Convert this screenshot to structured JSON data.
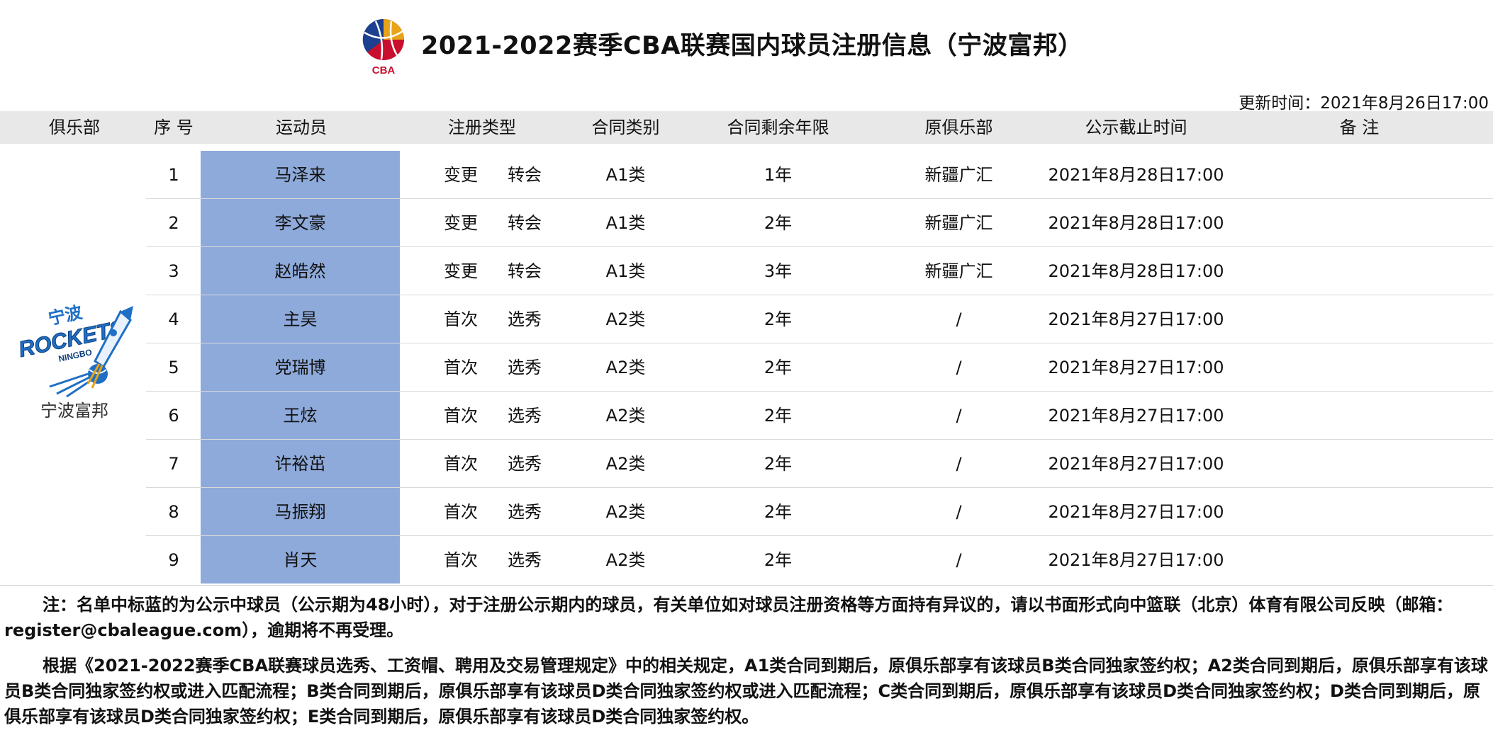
{
  "header": {
    "title": "2021-2022赛季CBA联赛国内球员注册信息（宁波富邦）",
    "logo_text": "CBA",
    "updated": "更新时间：2021年8月26日17:00"
  },
  "columns": [
    "俱乐部",
    "序 号",
    "运动员",
    "注册类型",
    "合同类别",
    "合同剩余年限",
    "原俱乐部",
    "公示截止时间",
    "备 注"
  ],
  "club": {
    "name": "宁波富邦",
    "logo_text": "ROCKETS",
    "logo_sub": "NINGBO",
    "logo_cn": "宁波"
  },
  "rows": [
    {
      "no": "1",
      "player": "马泽来",
      "reg1": "变更",
      "reg2": "转会",
      "contract": "A1类",
      "years": "1年",
      "orig": "新疆广汇",
      "deadline": "2021年8月28日17:00",
      "note": ""
    },
    {
      "no": "2",
      "player": "李文豪",
      "reg1": "变更",
      "reg2": "转会",
      "contract": "A1类",
      "years": "2年",
      "orig": "新疆广汇",
      "deadline": "2021年8月28日17:00",
      "note": ""
    },
    {
      "no": "3",
      "player": "赵皓然",
      "reg1": "变更",
      "reg2": "转会",
      "contract": "A1类",
      "years": "3年",
      "orig": "新疆广汇",
      "deadline": "2021年8月28日17:00",
      "note": ""
    },
    {
      "no": "4",
      "player": "主昊",
      "reg1": "首次",
      "reg2": "选秀",
      "contract": "A2类",
      "years": "2年",
      "orig": "/",
      "deadline": "2021年8月27日17:00",
      "note": ""
    },
    {
      "no": "5",
      "player": "党瑞博",
      "reg1": "首次",
      "reg2": "选秀",
      "contract": "A2类",
      "years": "2年",
      "orig": "/",
      "deadline": "2021年8月27日17:00",
      "note": ""
    },
    {
      "no": "6",
      "player": "王炫",
      "reg1": "首次",
      "reg2": "选秀",
      "contract": "A2类",
      "years": "2年",
      "orig": "/",
      "deadline": "2021年8月27日17:00",
      "note": ""
    },
    {
      "no": "7",
      "player": "许裕茁",
      "reg1": "首次",
      "reg2": "选秀",
      "contract": "A2类",
      "years": "2年",
      "orig": "/",
      "deadline": "2021年8月27日17:00",
      "note": ""
    },
    {
      "no": "8",
      "player": "马振翔",
      "reg1": "首次",
      "reg2": "选秀",
      "contract": "A2类",
      "years": "2年",
      "orig": "/",
      "deadline": "2021年8月27日17:00",
      "note": ""
    },
    {
      "no": "9",
      "player": "肖天",
      "reg1": "首次",
      "reg2": "选秀",
      "contract": "A2类",
      "years": "2年",
      "orig": "/",
      "deadline": "2021年8月27日17:00",
      "note": ""
    }
  ],
  "notes": {
    "p1": "注：名单中标蓝的为公示中球员（公示期为48小时），对于注册公示期内的球员，有关单位如对球员注册资格等方面持有异议的，请以书面形式向中篮联（北京）体育有限公司反映（邮箱：register@cbaleague.com），逾期将不再受理。",
    "p2": "根据《2021-2022赛季CBA联赛球员选秀、工资帽、聘用及交易管理规定》中的相关规定，A1类合同到期后，原俱乐部享有该球员B类合同独家签约权；A2类合同到期后，原俱乐部享有该球员B类合同独家签约权或进入匹配流程；B类合同到期后，原俱乐部享有该球员D类合同独家签约权或进入匹配流程；C类合同到期后，原俱乐部享有该球员D类合同独家签约权；D类合同到期后，原俱乐部享有该球员D类合同独家签约权；E类合同到期后，原俱乐部享有该球员D类合同独家签约权。"
  },
  "colors": {
    "highlight": "#8eaadb",
    "header_bg": "#e8e8e8",
    "cba_red": "#c8102e",
    "rockets_blue": "#1f6fc5"
  }
}
